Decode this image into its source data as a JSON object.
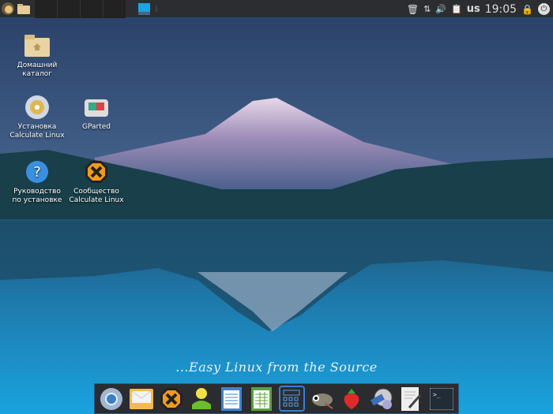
{
  "panel": {
    "clock": "19:05",
    "keyboard_layout": "us"
  },
  "desktop_icons": [
    {
      "label1": "Домашний",
      "label2": "каталог",
      "icon": "home-folder-icon"
    },
    {
      "label1": "Установка",
      "label2": "Calculate Linux",
      "icon": "install-disc-icon"
    },
    {
      "label1": "GParted",
      "label2": "",
      "icon": "gparted-icon"
    },
    {
      "label1": "Руководство",
      "label2": "по установке",
      "icon": "help-icon"
    },
    {
      "label1": "Сообщество",
      "label2": "Calculate Linux",
      "icon": "calculate-community-icon"
    }
  ],
  "tagline": "...Easy Linux from the Source",
  "dock": [
    "chromium",
    "mail",
    "calculate",
    "contacts",
    "writer",
    "calc-spreadsheet",
    "calculator",
    "gimp",
    "strawberry",
    "video-player",
    "text-editor",
    "terminal"
  ]
}
